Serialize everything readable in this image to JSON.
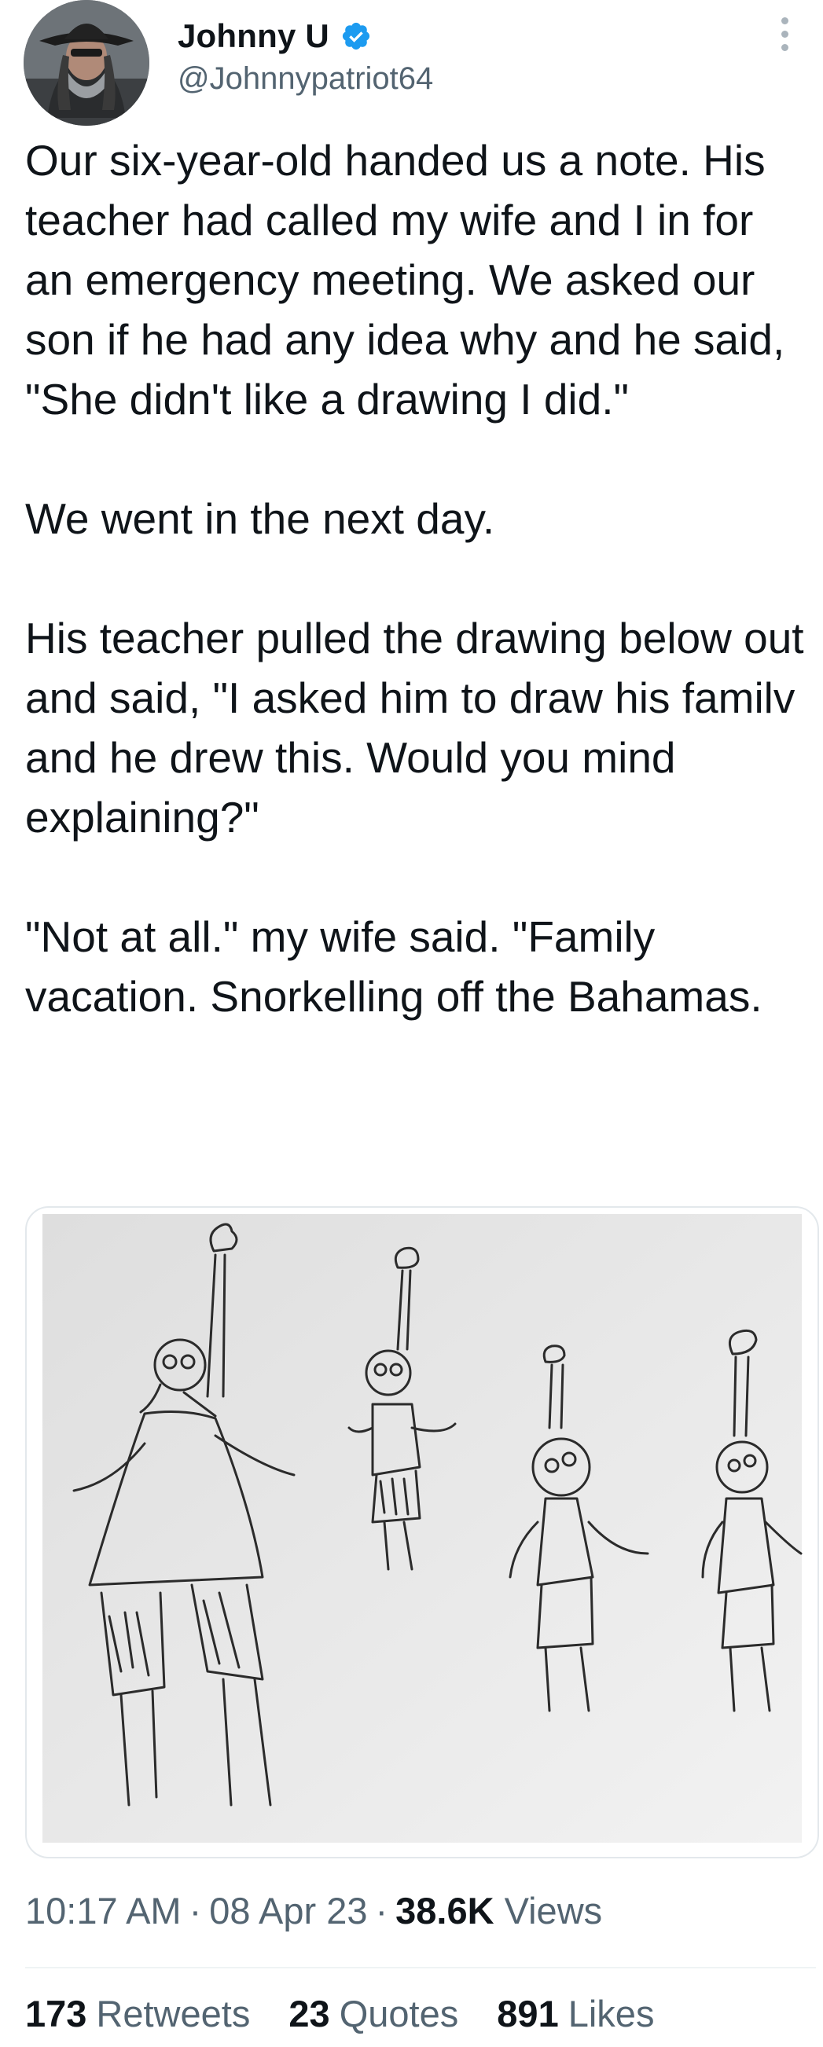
{
  "author": {
    "name": "Johnny U",
    "handle": "@Johnnypatriot64",
    "verified": true
  },
  "tweet": {
    "paragraphs": [
      "Our six-year-old handed us a note. His teacher had called my wife and I in for an emergency meeting. We asked our son if he had any idea why and he said, \"She didn't like a drawing I did.\"",
      "We went in the next day.",
      "His teacher pulled the drawing below out and said, \"I asked him to draw his familv and he drew this. Would you mind explaining?\"",
      "\"Not at all.\" my wife said. \"Family vacation. Snorkelling off the Bahamas."
    ]
  },
  "meta": {
    "time": "10:17 AM",
    "date": "08 Apr 23",
    "views_count": "38.6K",
    "views_label": "Views"
  },
  "stats": {
    "retweets_count": "173",
    "retweets_label": "Retweets",
    "quotes_count": "23",
    "quotes_label": "Quotes",
    "likes_count": "891",
    "likes_label": "Likes"
  },
  "colors": {
    "text": "#0f1419",
    "secondary": "#536471",
    "verified": "#1d9bf0",
    "border": "#eff3f4"
  },
  "icons": [
    "verified-badge-icon",
    "more-options-icon"
  ]
}
